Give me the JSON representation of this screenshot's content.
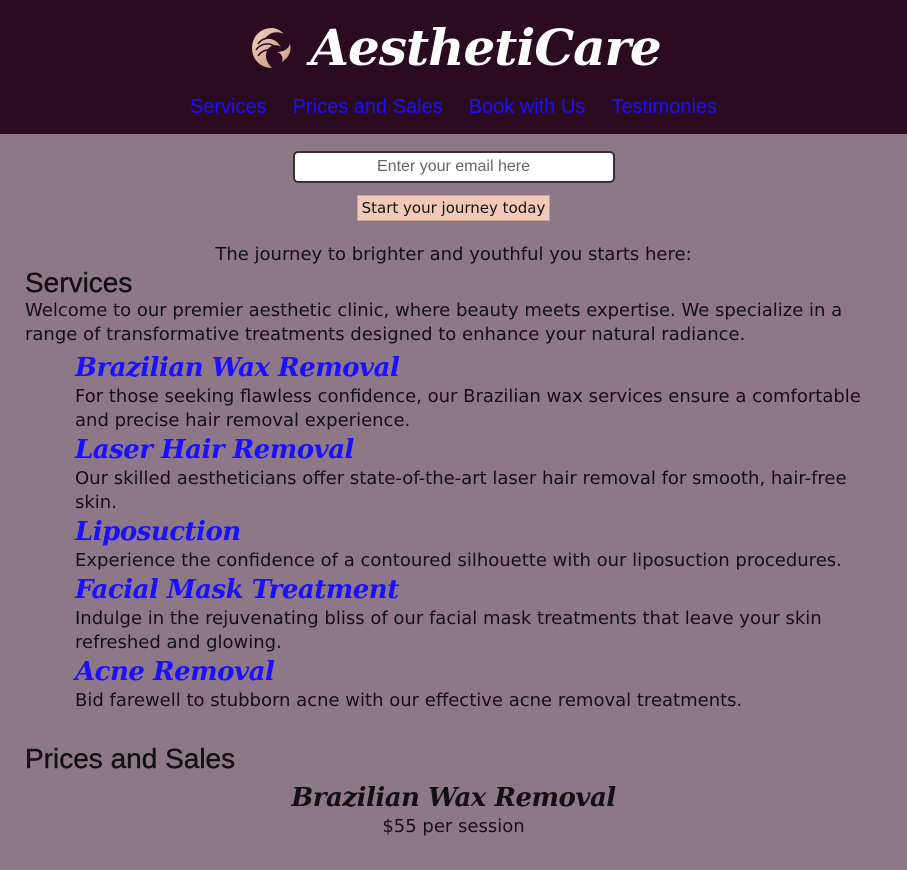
{
  "brand": {
    "name": "AesthetiCare",
    "logo_icon": "swirl-face-logo-icon"
  },
  "nav": {
    "items": [
      {
        "label": "Services"
      },
      {
        "label": "Prices and Sales"
      },
      {
        "label": "Book with Us"
      },
      {
        "label": "Testimonies"
      }
    ]
  },
  "signup": {
    "placeholder": "Enter your email here",
    "button_label": "Start your journey today"
  },
  "tagline": "The journey to brighter and youthful you starts here:",
  "services": {
    "heading": "Services",
    "intro": "Welcome to our premier aesthetic clinic, where beauty meets expertise. We specialize in a range of transformative treatments designed to enhance your natural radiance.",
    "items": [
      {
        "title": "Brazilian Wax Removal",
        "description": "For those seeking flawless confidence, our Brazilian wax services ensure a comfortable and precise hair removal experience."
      },
      {
        "title": "Laser Hair Removal",
        "description": "Our skilled aestheticians offer state-of-the-art laser hair removal for smooth, hair-free skin."
      },
      {
        "title": "Liposuction",
        "description": "Experience the confidence of a contoured silhouette with our liposuction procedures."
      },
      {
        "title": "Facial Mask Treatment",
        "description": "Indulge in the rejuvenating bliss of our facial mask treatments that leave your skin refreshed and glowing."
      },
      {
        "title": "Acne Removal",
        "description": "Bid farewell to stubborn acne with our effective acne removal treatments."
      }
    ]
  },
  "prices": {
    "heading": "Prices and Sales",
    "items": [
      {
        "title": "Brazilian Wax Removal",
        "price": "$55 per session"
      }
    ]
  },
  "colors": {
    "header_bg": "#2a0b1f",
    "page_bg": "#8e7888",
    "link": "#1a10ff",
    "button_bg": "#f2c8b8"
  }
}
